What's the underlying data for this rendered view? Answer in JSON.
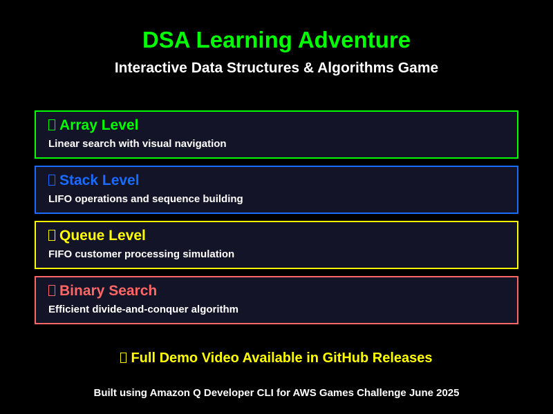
{
  "header": {
    "title": "DSA Learning Adventure",
    "subtitle": "Interactive Data Structures & Algorithms Game",
    "title_color": "#00ff00"
  },
  "levels": [
    {
      "title": "Array Level",
      "description": "Linear search with visual navigation",
      "color": "#00ff00",
      "icon": "missing-glyph-icon"
    },
    {
      "title": "Stack Level",
      "description": "LIFO operations and sequence building",
      "color": "#1a6bff",
      "icon": "missing-glyph-icon"
    },
    {
      "title": "Queue Level",
      "description": "FIFO customer processing simulation",
      "color": "#ffff00",
      "icon": "missing-glyph-icon"
    },
    {
      "title": "Binary Search",
      "description": "Efficient divide-and-conquer algorithm",
      "color": "#ff6666",
      "icon": "missing-glyph-icon"
    }
  ],
  "demo_note": {
    "text": "Full Demo Video Available in GitHub Releases",
    "color": "#ffff00",
    "icon": "missing-glyph-icon"
  },
  "footer": {
    "text": "Built using Amazon Q Developer CLI for AWS Games Challenge June 2025"
  }
}
